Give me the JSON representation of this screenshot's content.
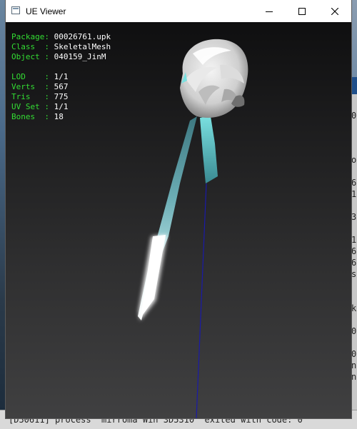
{
  "window": {
    "title": "UE Viewer"
  },
  "info": {
    "package_key": "Package: ",
    "package_val": "00026761.upk",
    "class_key": "Class  : ",
    "class_val": "SkeletalMesh",
    "object_key": "Object : ",
    "object_val": "040159_JinM",
    "lod_key": "LOD    : ",
    "lod_val": "1/1",
    "verts_key": "Verts  : ",
    "verts_val": "567",
    "tris_key": "Tris   : ",
    "tris_val": "775",
    "uvset_key": "UV Set : ",
    "uvset_val": "1/1",
    "bones_key": "Bones  : ",
    "bones_val": "18"
  },
  "background": {
    "bottom_text": "[D50611] process \"mirroma Win 3D5310\" exited with code: 0",
    "frag_1": "0",
    "frag_2": "o",
    "frag_3": "6",
    "frag_4": "1",
    "frag_5": "3",
    "frag_6": "1",
    "frag_7": "6",
    "frag_8": "6",
    "frag_9": "s",
    "frag_10": "k",
    "frag_11": "0",
    "frag_12": "0",
    "frag_13": "n",
    "frag_14": "n"
  },
  "colors": {
    "label_green": "#33dd33",
    "value_white": "#ffffff",
    "bone_line": "#1a1aa8",
    "ribbon": "#8fe6e6"
  }
}
